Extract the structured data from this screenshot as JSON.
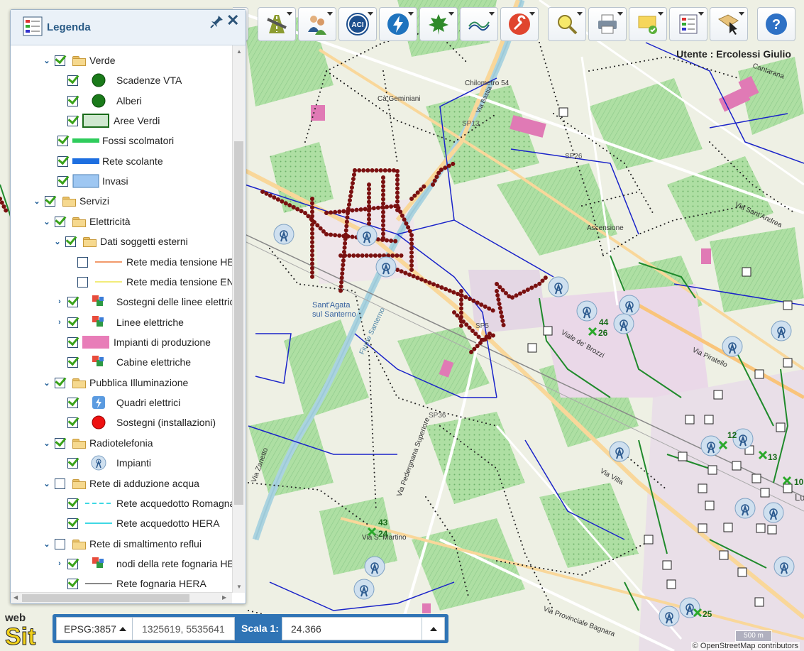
{
  "app": {
    "logo_text_top": "web",
    "logo_text_bottom": "Sit"
  },
  "toolbar": {
    "buttons": [
      {
        "name": "layers-tool",
        "icon": "layer-cards-icon"
      },
      {
        "name": "road-tool",
        "icon": "road-icon"
      },
      {
        "name": "users-tool",
        "icon": "users-icon"
      },
      {
        "name": "aci-tool",
        "icon": "aci-logo-icon",
        "label": "ACI"
      },
      {
        "name": "electricity-tool",
        "icon": "lightning-icon"
      },
      {
        "name": "green-tool",
        "icon": "leaf-icon"
      },
      {
        "name": "consorzio-tool",
        "icon": "waves-logo-icon"
      },
      {
        "name": "settings-tool",
        "icon": "wrench-icon"
      },
      {
        "name": "search-tool",
        "icon": "magnifier-icon"
      },
      {
        "name": "print-tool",
        "icon": "printer-icon"
      },
      {
        "name": "notes-tool",
        "icon": "note-check-icon"
      },
      {
        "name": "legend-tool",
        "icon": "legend-list-icon"
      },
      {
        "name": "identify-tool",
        "icon": "map-cursor-icon"
      },
      {
        "name": "help-tool",
        "icon": "help-icon"
      }
    ]
  },
  "user": {
    "label": "Utente : Ercolessi Giulio"
  },
  "legend": {
    "title": "Legenda",
    "items": [
      {
        "label": "Verde"
      },
      {
        "label": "Scadenze VTA"
      },
      {
        "label": "Alberi"
      },
      {
        "label": "Aree Verdi"
      },
      {
        "label": "Fossi scolmatori"
      },
      {
        "label": "Rete scolante"
      },
      {
        "label": "Invasi"
      },
      {
        "label": "Servizi"
      },
      {
        "label": "Elettricità"
      },
      {
        "label": "Dati soggetti esterni"
      },
      {
        "label": "Rete media tensione HERA"
      },
      {
        "label": "Rete media tensione ENEL"
      },
      {
        "label": "Sostegni delle linee elettriche"
      },
      {
        "label": "Linee elettriche"
      },
      {
        "label": "Impianti di produzione"
      },
      {
        "label": "Cabine elettriche"
      },
      {
        "label": "Pubblica Illuminazione"
      },
      {
        "label": "Quadri elettrici"
      },
      {
        "label": "Sostegni (installazioni)"
      },
      {
        "label": "Radiotelefonia"
      },
      {
        "label": "Impianti"
      },
      {
        "label": "Rete di adduzione acqua"
      },
      {
        "label": "Rete acquedotto Romagna"
      },
      {
        "label": "Rete acquedotto HERA"
      },
      {
        "label": "Rete di smaltimento reflui"
      },
      {
        "label": "nodi della rete fognaria HERA"
      },
      {
        "label": "Rete fognaria HERA"
      }
    ]
  },
  "map": {
    "labels": {
      "chilometro": "Chilometro 54",
      "ca_geminiani": "Cà Geminiani",
      "sp13": "SP13",
      "sp26": "SP26",
      "sp36": "SP36",
      "sp5": "SP5",
      "town": "Sant'Agata",
      "town2": "sul Santerno",
      "ascensione": "Ascensione",
      "via_piratello": "Via Piratello",
      "viale_brozzi": "Viale de' Brozzi",
      "via_villa": "Via Villa",
      "via_pedergnana": "Via Pedergnana Superiore",
      "via_provinciale": "Via Provinciale Bagnara",
      "via_sant_andrea": "Via Sant'Andrea",
      "via_bastia": "Via Bastia",
      "cantarana": "Cantarana",
      "fiume": "Fiume Santerno",
      "via_martino": "Via S. Martino",
      "lugo": "Lugo",
      "via_zanetto": "Via Zanetto",
      "n44": "44",
      "n26": "26",
      "n12": "12",
      "n13": "13",
      "n43": "43",
      "n24": "24",
      "n25": "25",
      "n10": "10"
    },
    "scalebar": "500 m",
    "attribution": "© OpenStreetMap contributors"
  },
  "bottombar": {
    "crs": "EPSG:3857",
    "coords": "1325619, 5535641",
    "scale_label": "Scala 1:",
    "scale_value": "24.366"
  },
  "colors": {
    "accent": "#2f74b5",
    "fiber_dots": "#7a1010",
    "boundary": "#1a23c9",
    "green_lines": "#1f8a2b",
    "water": "#aad3df"
  }
}
